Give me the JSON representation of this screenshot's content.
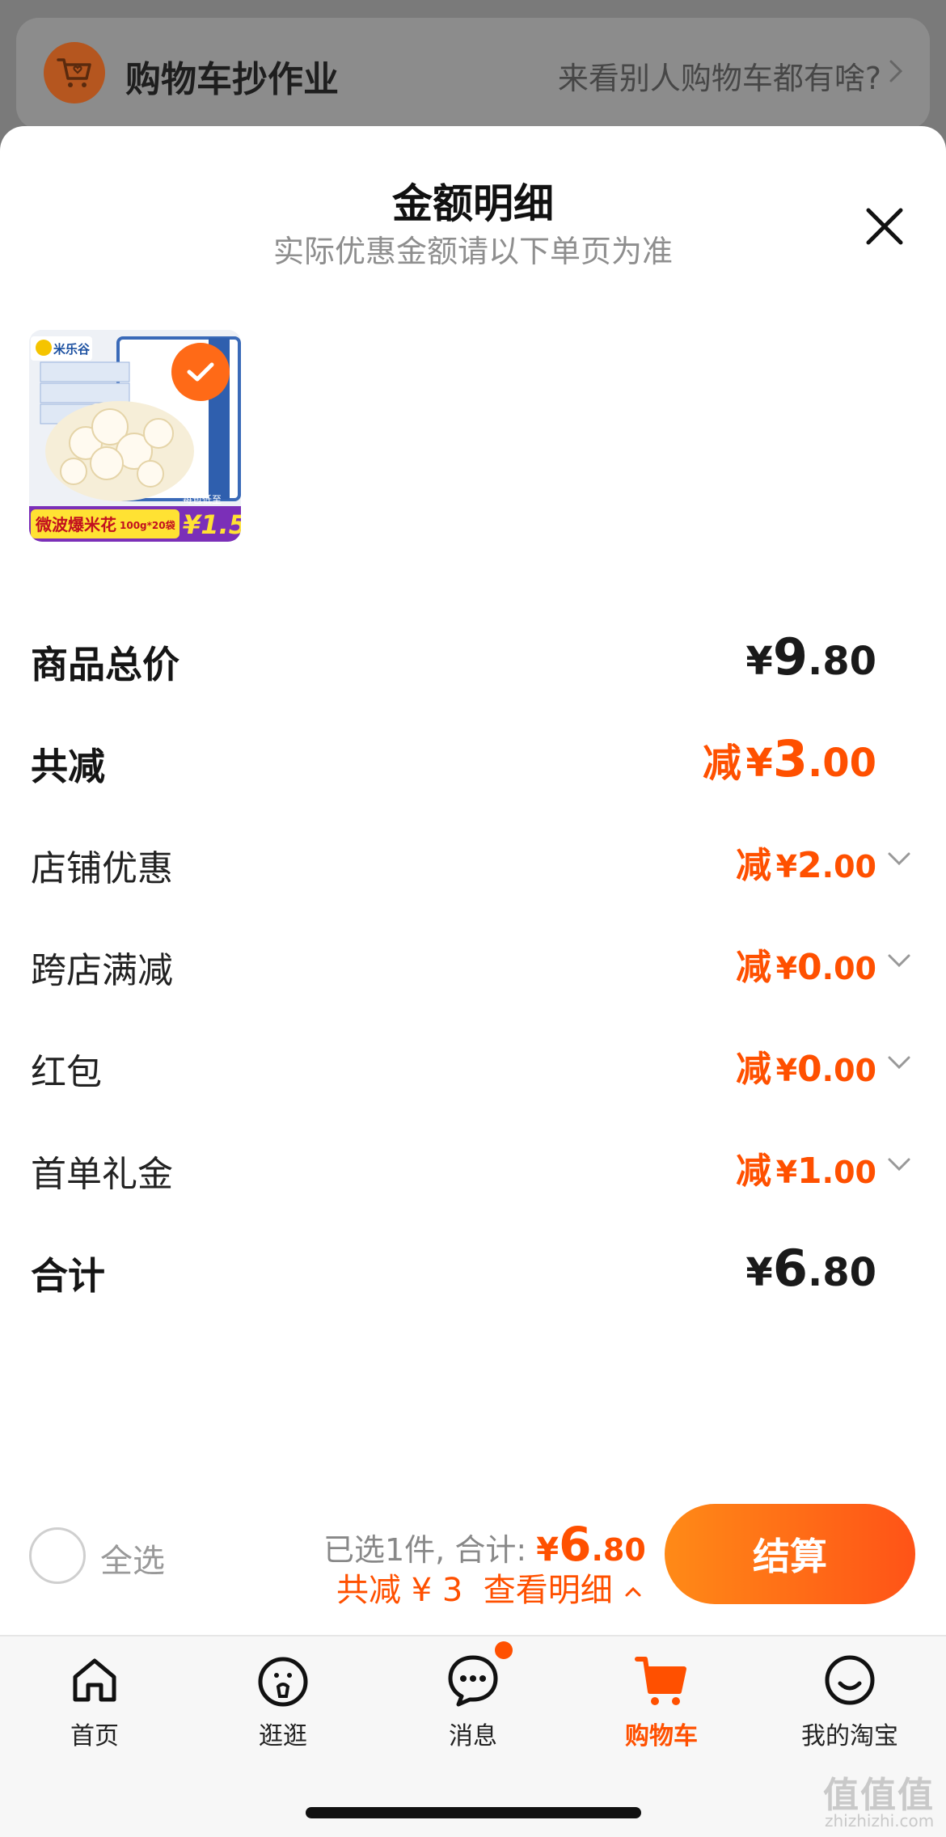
{
  "banner": {
    "title": "购物车抄作业",
    "link": "来看别人购物车都有啥?"
  },
  "sheet": {
    "title": "金额明细",
    "subtitle": "实际优惠金额请以下单页为准",
    "product_image": {
      "alt": "微波爆米花 100g*20袋",
      "brand": "米乐谷",
      "caption": "微波爆米花",
      "spec": "100g*20袋",
      "promo_label": "每包低至",
      "promo_price": "¥1.5"
    }
  },
  "rows": {
    "total_price": {
      "label": "商品总价",
      "yen": "¥",
      "int": "9",
      "dec": ".80"
    },
    "total_discount": {
      "label": "共减",
      "prefix": "减",
      "yen": "¥",
      "int": "3",
      "dec": ".00"
    },
    "shop_discount": {
      "label": "店铺优惠",
      "prefix": "减",
      "yen": "¥",
      "int": "2",
      "dec": ".00"
    },
    "cross_store": {
      "label": "跨店满减",
      "prefix": "减",
      "yen": "¥",
      "int": "0",
      "dec": ".00"
    },
    "red_packet": {
      "label": "红包",
      "prefix": "减",
      "yen": "¥",
      "int": "0",
      "dec": ".00"
    },
    "first_order": {
      "label": "首单礼金",
      "prefix": "减",
      "yen": "¥",
      "int": "1",
      "dec": ".00"
    },
    "grand_total": {
      "label": "合计",
      "yen": "¥",
      "int": "6",
      "dec": ".80"
    }
  },
  "footer": {
    "select_all": "全选",
    "selected_text": "已选1件, 合计:",
    "yen": "¥",
    "total_int": "6",
    "total_dec": ".80",
    "discount_text": "共减 ¥ 3",
    "detail_link": "查看明细",
    "checkout": "结算"
  },
  "tabs": [
    {
      "label": "首页",
      "icon": "home-icon"
    },
    {
      "label": "逛逛",
      "icon": "browse-icon"
    },
    {
      "label": "消息",
      "icon": "message-icon"
    },
    {
      "label": "购物车",
      "icon": "cart-icon",
      "active": true
    },
    {
      "label": "我的淘宝",
      "icon": "profile-icon"
    }
  ],
  "watermark": {
    "text": "值值值",
    "url": "zhizhizhi.com"
  },
  "colors": {
    "accent": "#ff5000",
    "checkout_start": "#ff8a17",
    "checkout_end": "#ff5317"
  }
}
